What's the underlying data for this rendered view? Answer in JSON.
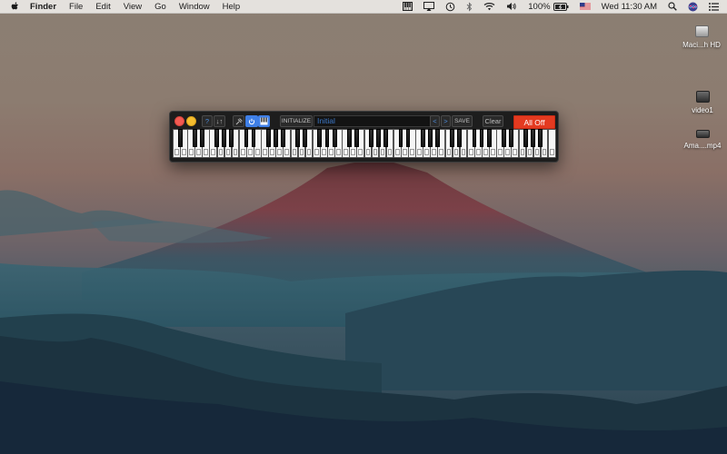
{
  "menubar": {
    "app_name": "Finder",
    "menus": [
      "File",
      "Edit",
      "View",
      "Go",
      "Window",
      "Help"
    ],
    "battery_percent": "100%",
    "clock": "Wed 11:30 AM"
  },
  "desktop": {
    "icons": [
      {
        "label": "Maci...h HD"
      },
      {
        "label": "video1"
      },
      {
        "label": "Ama....mp4"
      }
    ]
  },
  "piano": {
    "help_label": "?",
    "octave_label": "↓↑",
    "initialize_label": "INITIALIZE",
    "preset_value": "Initial",
    "prev_label": "<",
    "next_label": ">",
    "save_label": "SAVE",
    "clear_label": "Clear",
    "all_off_label": "All Off",
    "accent_color": "#3f7fe6",
    "all_off_color": "#e43a20"
  }
}
